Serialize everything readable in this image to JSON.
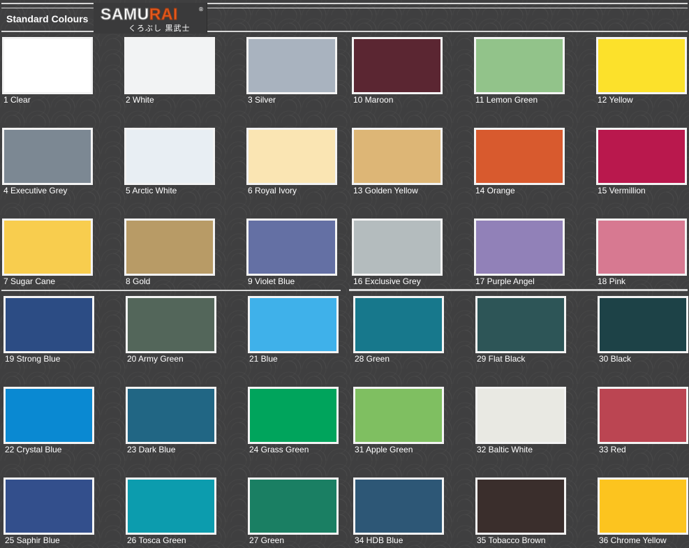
{
  "header": {
    "title": "Standard Colours",
    "logo": {
      "brand": "SAMURAI",
      "subtitle": "くろぶし 黒武士",
      "reg": "®"
    }
  },
  "swatches": [
    {
      "label": "1 Clear",
      "color": "#ffffff"
    },
    {
      "label": "2 White",
      "color": "#f2f3f4"
    },
    {
      "label": "3 Silver",
      "color": "#a9b3bf"
    },
    {
      "label": "10 Maroon",
      "color": "#5b2632"
    },
    {
      "label": "11 Lemon Green",
      "color": "#92c38a"
    },
    {
      "label": "12 Yellow",
      "color": "#fce12b"
    },
    {
      "label": "4 Executive Grey",
      "color": "#7c8893"
    },
    {
      "label": "5 Arctic White",
      "color": "#e8eef3"
    },
    {
      "label": "6 Royal Ivory",
      "color": "#fae5b3"
    },
    {
      "label": "13 Golden Yellow",
      "color": "#ddb676"
    },
    {
      "label": "14 Orange",
      "color": "#d85a2e"
    },
    {
      "label": "15 Vermillion",
      "color": "#b9184d"
    },
    {
      "label": "7 Sugar Cane",
      "color": "#f8cd4e"
    },
    {
      "label": "8 Gold",
      "color": "#b89b66"
    },
    {
      "label": "9 Violet Blue",
      "color": "#6470a4"
    },
    {
      "label": "16 Exclusive Grey",
      "color": "#b4bcbe"
    },
    {
      "label": "17 Purple Angel",
      "color": "#9181b8"
    },
    {
      "label": "18 Pink",
      "color": "#d77991"
    },
    {
      "label": "19 Strong Blue",
      "color": "#2c4c84"
    },
    {
      "label": "20 Army Green",
      "color": "#53665a"
    },
    {
      "label": "21 Blue",
      "color": "#3fb1ea"
    },
    {
      "label": "28 Green",
      "color": "#17788c"
    },
    {
      "label": "29 Flat Black",
      "color": "#2d5557"
    },
    {
      "label": "30 Black",
      "color": "#1d4247"
    },
    {
      "label": "22 Crystal Blue",
      "color": "#0a89d2"
    },
    {
      "label": "23 Dark Blue",
      "color": "#216684"
    },
    {
      "label": "24 Grass Green",
      "color": "#00a45c"
    },
    {
      "label": "31 Apple Green",
      "color": "#7fbf61"
    },
    {
      "label": "32 Baltic White",
      "color": "#e9e9e3"
    },
    {
      "label": "33 Red",
      "color": "#bb4552"
    },
    {
      "label": "25 Saphir Blue",
      "color": "#334f8c"
    },
    {
      "label": "26 Tosca Green",
      "color": "#0c9cae"
    },
    {
      "label": "27 Green",
      "color": "#1a7f63"
    },
    {
      "label": "34 HDB Blue",
      "color": "#2d5776"
    },
    {
      "label": "35 Tobacco Brown",
      "color": "#3a2e2c"
    },
    {
      "label": "36 Chrome Yellow",
      "color": "#fcc41f"
    }
  ]
}
